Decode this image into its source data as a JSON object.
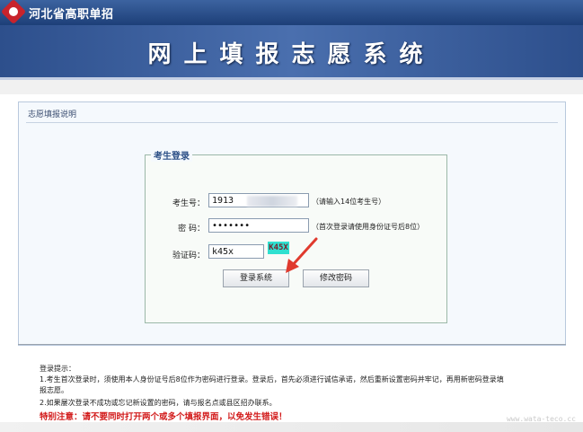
{
  "header": {
    "org_name": "河北省高职单招",
    "system_title": "网上填报志愿系统"
  },
  "panel": {
    "title": "志愿填报说明"
  },
  "login": {
    "legend": "考生登录",
    "exam_label": "考生号：",
    "exam_value": "1913",
    "exam_hint": "（请输入14位考生号）",
    "password_label": "密  码：",
    "password_value": "•••••••",
    "password_hint": "（首次登录请使用身份证号后8位）",
    "captcha_label": "验证码：",
    "captcha_value": "k45x",
    "captcha_image_text": "K45X",
    "login_button": "登录系统",
    "change_password_button": "修改密码"
  },
  "notes": {
    "title": "登录提示：",
    "items": [
      "1.考生首次登录时，须使用本人身份证号后8位作为密码进行登录。登录后，首先必须进行诚信承诺，然后重新设置密码并牢记，再用新密码登录填报志愿。",
      "2.如果屡次登录不成功或忘记新设置的密码，请与报名点或县区招办联系。"
    ],
    "warning": "特别注意：请不要同时打开两个或多个填报界面，以免发生错误！"
  },
  "watermark": "www.wata-teco.cc",
  "colors": {
    "banner": "#2d4f8c",
    "warning": "#d21a1a",
    "captcha_bg": "#2fe0d0",
    "arrow": "#e03a2e"
  }
}
